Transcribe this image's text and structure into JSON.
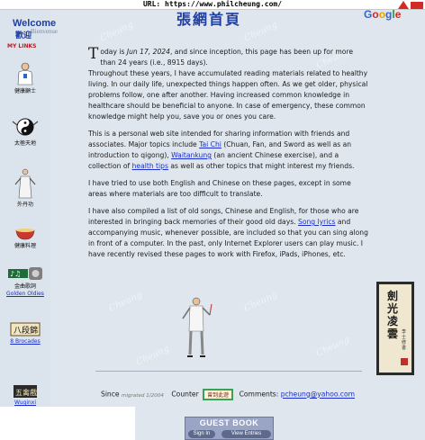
{
  "browser": {
    "url_line": "URL: https://www.philcheung.com/"
  },
  "header": {
    "welcome": "Welcome",
    "welcome_cn": "歡迎",
    "bienvenue": "Bienvenue",
    "title": "張網首頁",
    "google": [
      "G",
      "o",
      "o",
      "g",
      "l",
      "e"
    ]
  },
  "sidebar": {
    "heading": "MY LINKS",
    "items": [
      {
        "label": "健康顧士",
        "icon": "doctor-icon"
      },
      {
        "label": "太極天地",
        "icon": "yin-yang-icon"
      },
      {
        "label": "外丹功",
        "icon": "qigong-figure-icon"
      },
      {
        "label": "健康料理",
        "icon": "bowl-icon"
      },
      {
        "label": "金曲歌詞",
        "icon": "music-notes-icon",
        "sub_label": "Golden Oldies"
      },
      {
        "label": "八段錦",
        "icon": "brocade-sign-icon",
        "sub_label": "8 Brocades"
      },
      {
        "label": "五禽戲",
        "icon": "five-animals-sign-icon",
        "sub_label": "Wuqinxi"
      }
    ]
  },
  "content": {
    "p1_dropcap": "T",
    "p1_a": "oday is ",
    "p1_date": "Jun 17, 2024",
    "p1_b": ", and since inception, this page has been up for more than 24 years (i.e., 8915 days).",
    "p1_c": "Throughout these years, I have accumulated reading materials related to healthy living. In our daily life, unexpected things happen often. As we get older, physical problems follow, one after another. Having increased common knowledge in healthcare should be beneficial to anyone. In case of emergency, these common knowledge might help you, save you or ones you care.",
    "p2_a": "This is a personal web site intended for sharing information with friends and associates. Major topics include ",
    "p2_link1": "Tai Chi",
    "p2_b": " (Chuan, Fan, and Sword as well as an introduction to qigong), ",
    "p2_link2": "Waitankung",
    "p2_c": " (an ancient Chinese exercise), and a collection of ",
    "p2_link3": "health tips",
    "p2_d": " as well as other topics that might interest my friends.",
    "p3": "I have tried to use both English and Chinese on these pages, except in some areas where materials are too difficult to translate.",
    "p4_a": "I have also compiled a list of old songs, Chinese and English, for those who are interested in bringing back memories of their good old days.  ",
    "p4_link": "Song lyrics",
    "p4_b": " and accompanying music, whenever possible, are included so that you can sing along in front of a computer. In the past, only Internet Explorer users can play music. I have recently revised these pages to work with Firefox, iPads, iPhones, etc."
  },
  "scroll": {
    "calligraphy": [
      "劍",
      "光",
      "凌",
      "雲"
    ],
    "inscription": "李士修書"
  },
  "footer": {
    "since": "Since",
    "migrated": "migrated 1/2004",
    "counter_label": "Counter",
    "counter_value": "曾到此遊",
    "comments_label": "Comments:",
    "email": "pcheung@yahoo.com"
  },
  "guestbook": {
    "title": "GUEST BOOK",
    "sign_in": "Sign In",
    "view_entries": "View Entries"
  },
  "watermark": "Cheung"
}
